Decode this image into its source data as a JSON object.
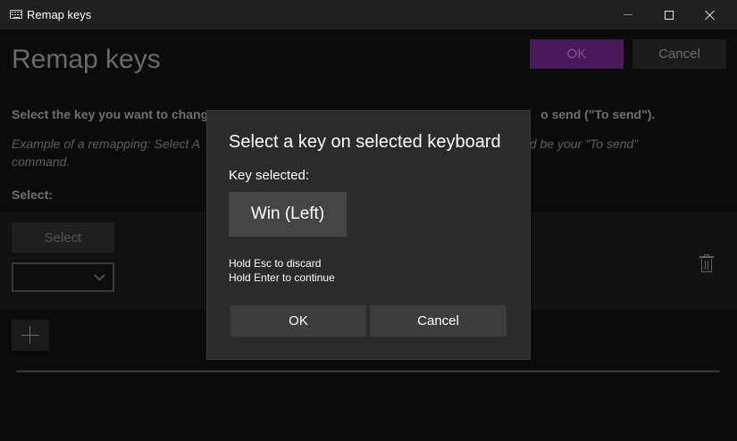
{
  "window": {
    "title": "Remap keys",
    "icon": "keyboard-icon"
  },
  "page": {
    "title": "Remap keys",
    "ok_label": "OK",
    "cancel_label": "Cancel",
    "accent_color": "#4a1a5a",
    "instruction_left": "Select the key you want to chang",
    "instruction_right": "o send (\"To send\").",
    "example_left_line1": "Example of a remapping: Select A",
    "example_right_line1": "\" would be your \"To send\"",
    "example_line2": "command.",
    "select_label": "Select:",
    "row": {
      "select_button_label": "Select",
      "dropdown_value": ""
    }
  },
  "dialog": {
    "title": "Select a key on selected keyboard",
    "key_selected_label": "Key selected:",
    "key_value": "Win (Left)",
    "hint_discard": "Hold Esc to discard",
    "hint_continue": "Hold Enter to continue",
    "ok_label": "OK",
    "cancel_label": "Cancel"
  }
}
